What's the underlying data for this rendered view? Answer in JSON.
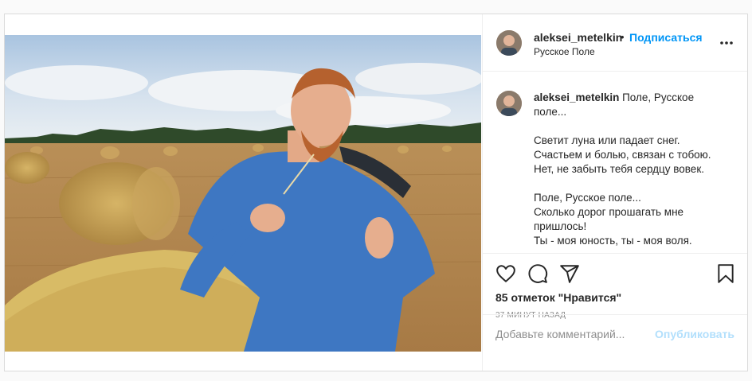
{
  "post": {
    "username": "aleksei_metelkin",
    "separator": "•",
    "follow_label": "Подписаться",
    "location": "Русское Поле",
    "caption_username": "aleksei_metelkin",
    "caption_lines": [
      "Поле, Русское",
      "поле...",
      "",
      "Светит луна или падает снег.",
      "Счастьем и болью, связан с тобою.",
      "Нет, не забыть тебя сердцу вовек.",
      "",
      "Поле, Русское поле...",
      "Сколько дорог прошагать мне",
      "пришлось!",
      "Ты - моя юность, ты - моя воля."
    ],
    "likes_text": "85 отметок \"Нравится\"",
    "time_text": "37 минут назад",
    "comment_placeholder": "Добавьте комментарий...",
    "publish_label": "Опубликовать"
  },
  "icons": {
    "more": "more-icon",
    "like": "heart-icon",
    "comment": "comment-icon",
    "share": "share-icon",
    "save": "bookmark-icon"
  },
  "colors": {
    "link": "#0095f6",
    "publish_disabled": "#b2dffc",
    "border": "#dbdbdb"
  }
}
